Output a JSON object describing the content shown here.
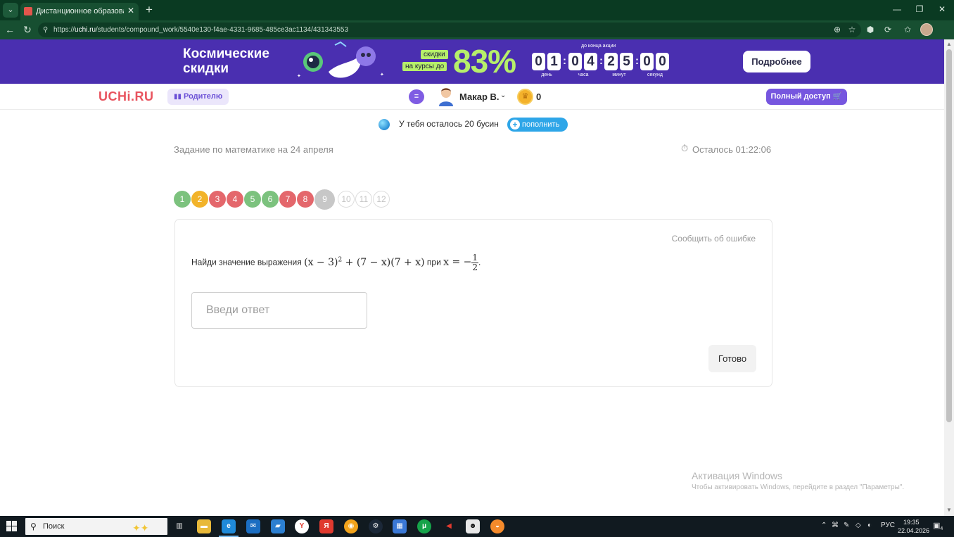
{
  "browser": {
    "tab_title": "Дистанционное образование для",
    "tab_close": "✕",
    "new_tab": "+",
    "url_prefix": "https://",
    "url_host": "uchi.ru",
    "url_path": "/students/compound_work/5540e130-f4ae-4331-9685-485ce3ac1134/431343553",
    "minimize": "—",
    "maximize": "❐",
    "close": "✕"
  },
  "promo": {
    "title": "Космические скидки",
    "tag1": "скидки",
    "tag2": "на курсы до",
    "percent": "83%",
    "until_label": "до конца акции",
    "digits": [
      "0",
      "1",
      "0",
      "4",
      "2",
      "5",
      "0",
      "0"
    ],
    "units": [
      "день",
      "часа",
      "минут",
      "секунд"
    ],
    "more_label": "Подробнее"
  },
  "header": {
    "logo": "UCHi.RU",
    "parent_label": "Родителю",
    "user_name": "Макар В.",
    "coins": "0",
    "full_access_label": "Полный доступ 🛒"
  },
  "beads": {
    "text": "У тебя осталось 20 бусин",
    "refill_label": "пополнить"
  },
  "task": {
    "title": "Задание по математике на 24 апреля",
    "timer": "Осталось 01:22:06",
    "questions": [
      {
        "label": "1",
        "status": "correct"
      },
      {
        "label": "2",
        "status": "partial"
      },
      {
        "label": "3",
        "status": "wrong"
      },
      {
        "label": "4",
        "status": "wrong"
      },
      {
        "label": "5",
        "status": "correct"
      },
      {
        "label": "6",
        "status": "correct"
      },
      {
        "label": "7",
        "status": "wrong"
      },
      {
        "label": "8",
        "status": "wrong"
      },
      {
        "label": "9",
        "status": "current"
      },
      {
        "label": "10",
        "status": "empty"
      },
      {
        "label": "11",
        "status": "empty"
      },
      {
        "label": "12",
        "status": "empty"
      }
    ],
    "status_colors": {
      "correct": "#7cc27e",
      "partial": "#f2b32a",
      "wrong": "#e4676c",
      "current": "#c7c7c7",
      "empty": "#ffffff"
    },
    "report_error": "Сообщить об ошибке",
    "question_prefix": "Найди значение выражения",
    "expr_part1": "(x − 3)",
    "expr_exp": "2",
    "expr_part2": " + (7 − x)(7 + x)",
    "question_mid": "при",
    "expr_var": "x = −",
    "frac_num": "1",
    "frac_den": "2",
    "expr_end": ".",
    "answer_placeholder": "Введи ответ",
    "answer_value": "",
    "done_label": "Готово"
  },
  "watermark": {
    "title": "Активация Windows",
    "subtitle": "Чтобы активировать Windows, перейдите в раздел \"Параметры\"."
  },
  "taskbar": {
    "search_label": "Поиск",
    "language": "РУС",
    "time": "19:35",
    "date": "22.04.2026",
    "notification_count": "4"
  }
}
